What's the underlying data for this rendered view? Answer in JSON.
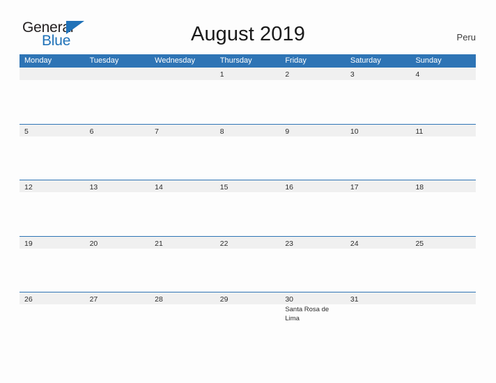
{
  "brand": {
    "name_part1": "General",
    "name_part2": "Blue",
    "triangle_icon": "triangle-icon",
    "color_dark": "#231f20",
    "color_blue": "#2072b8"
  },
  "header": {
    "title": "August 2019",
    "locale": "Peru"
  },
  "theme": {
    "header_blue": "#2e74b5",
    "band_gray": "#f0f0f0",
    "page_background": "#fdfdfd",
    "text_color": "#2b2b2b"
  },
  "calendar": {
    "month": "August",
    "year": "2019",
    "weekdays": [
      "Monday",
      "Tuesday",
      "Wednesday",
      "Thursday",
      "Friday",
      "Saturday",
      "Sunday"
    ],
    "weeks": [
      {
        "days": [
          {
            "num": "",
            "event": ""
          },
          {
            "num": "",
            "event": ""
          },
          {
            "num": "",
            "event": ""
          },
          {
            "num": "1",
            "event": ""
          },
          {
            "num": "2",
            "event": ""
          },
          {
            "num": "3",
            "event": ""
          },
          {
            "num": "4",
            "event": ""
          }
        ]
      },
      {
        "days": [
          {
            "num": "5",
            "event": ""
          },
          {
            "num": "6",
            "event": ""
          },
          {
            "num": "7",
            "event": ""
          },
          {
            "num": "8",
            "event": ""
          },
          {
            "num": "9",
            "event": ""
          },
          {
            "num": "10",
            "event": ""
          },
          {
            "num": "11",
            "event": ""
          }
        ]
      },
      {
        "days": [
          {
            "num": "12",
            "event": ""
          },
          {
            "num": "13",
            "event": ""
          },
          {
            "num": "14",
            "event": ""
          },
          {
            "num": "15",
            "event": ""
          },
          {
            "num": "16",
            "event": ""
          },
          {
            "num": "17",
            "event": ""
          },
          {
            "num": "18",
            "event": ""
          }
        ]
      },
      {
        "days": [
          {
            "num": "19",
            "event": ""
          },
          {
            "num": "20",
            "event": ""
          },
          {
            "num": "21",
            "event": ""
          },
          {
            "num": "22",
            "event": ""
          },
          {
            "num": "23",
            "event": ""
          },
          {
            "num": "24",
            "event": ""
          },
          {
            "num": "25",
            "event": ""
          }
        ]
      },
      {
        "days": [
          {
            "num": "26",
            "event": ""
          },
          {
            "num": "27",
            "event": ""
          },
          {
            "num": "28",
            "event": ""
          },
          {
            "num": "29",
            "event": ""
          },
          {
            "num": "30",
            "event": "Santa Rosa de Lima"
          },
          {
            "num": "31",
            "event": ""
          },
          {
            "num": "",
            "event": ""
          }
        ]
      }
    ]
  }
}
